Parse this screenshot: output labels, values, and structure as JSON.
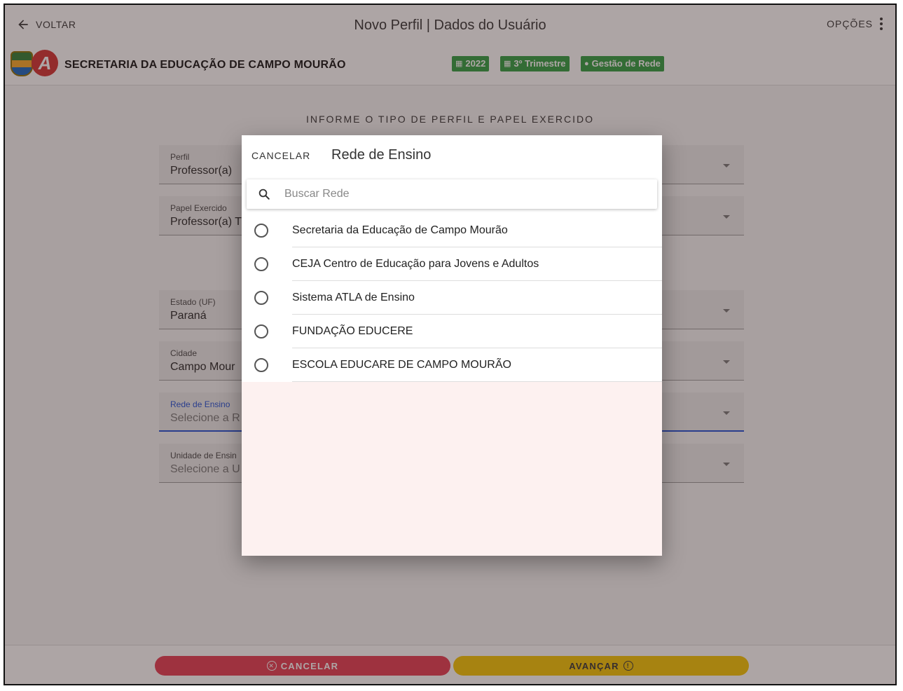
{
  "header": {
    "back_label": "VOLTAR",
    "title": "Novo Perfil | Dados do Usuário",
    "options_label": "OPÇÕES"
  },
  "org": {
    "name": "SECRETARIA DA EDUCAÇÃO DE CAMPO MOURÃO",
    "chips": [
      "2022",
      "3º Trimestre",
      "Gestão de Rede"
    ]
  },
  "form": {
    "section_title": "INFORME O TIPO DE PERFIL E PAPEL EXERCIDO",
    "fields": [
      {
        "label": "Perfil",
        "value": "Professor(a)"
      },
      {
        "label": "Papel Exercido",
        "value": "Professor(a) T"
      },
      {
        "label": "Estado (UF)",
        "value": "Paraná"
      },
      {
        "label": "Cidade",
        "value": "Campo Mour"
      },
      {
        "label": "Rede de Ensino",
        "value": "Selecione a R"
      },
      {
        "label": "Unidade de Ensin",
        "value": "Selecione a U"
      }
    ]
  },
  "footer": {
    "cancel_label": "CANCELAR",
    "next_label": "AVANÇAR"
  },
  "modal": {
    "cancel_label": "CANCELAR",
    "title": "Rede de Ensino",
    "search_placeholder": "Buscar Rede",
    "options": [
      "Secretaria da Educação de Campo Mourão",
      "CEJA Centro de Educação para Jovens e Adultos",
      "Sistema ATLA de Ensino",
      "FUNDAÇÃO EDUCERE",
      "ESCOLA EDUCARE DE CAMPO MOURÃO"
    ]
  },
  "colors": {
    "chip": "#2e9d3f",
    "cancel": "#e53950",
    "next": "#f5c400",
    "focus": "#1e4fd6"
  }
}
